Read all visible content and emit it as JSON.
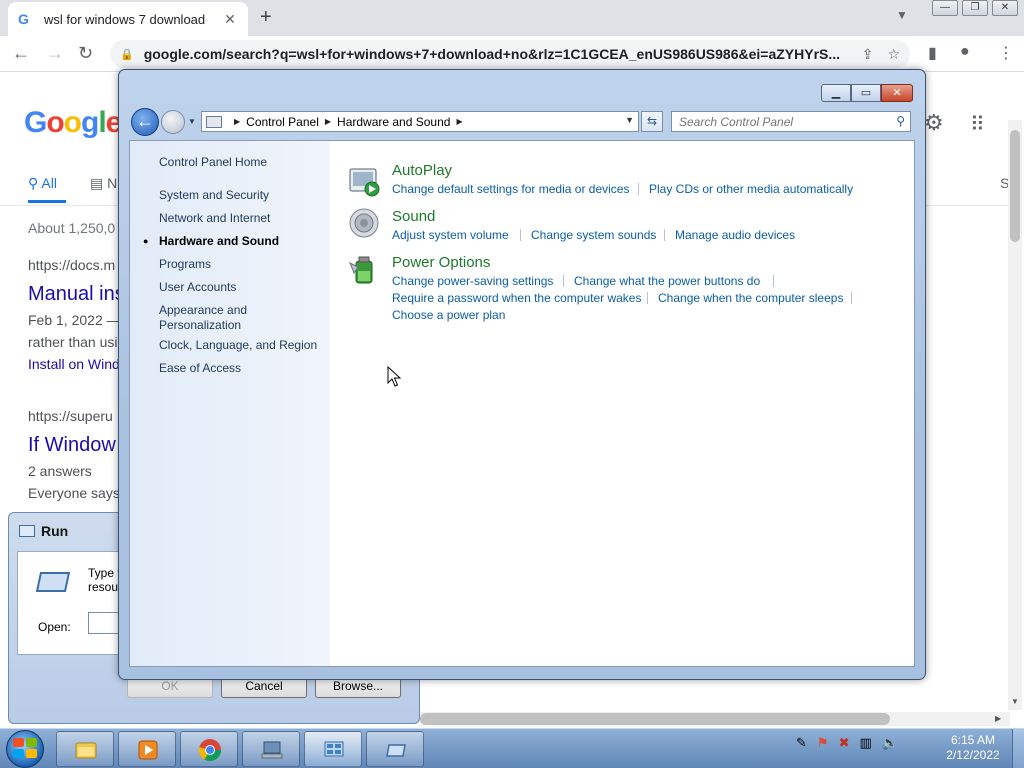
{
  "browser": {
    "tab_title": "wsl for windows 7 download",
    "tab_favicon": "G",
    "url": "google.com/search?q=wsl+for+windows+7+download+no&rlz=1C1GCEA_enUS986US986&ei=aZYHYrS..."
  },
  "google": {
    "logo": "Google",
    "tab_all": "All",
    "tab_n": "N",
    "tab_s": "S",
    "result_stats": "About 1,250,0",
    "result1_url": "https://docs.m",
    "result1_title": "Manual ins",
    "result1_snippet1": "Feb 1, 2022 —",
    "result1_snippet2": "rather than usi",
    "result1_link": "Install on Wind",
    "result2_url": "https://superu",
    "result2_title": "If Window",
    "result2_answers": "2 answers",
    "result2_snippet": "Everyone says,"
  },
  "run_dialog": {
    "title": "Run",
    "description": "Type th\nresourc",
    "open_label": "Open:",
    "ok_label": "OK",
    "cancel_label": "Cancel",
    "browse_label": "Browse..."
  },
  "control_panel": {
    "breadcrumb": [
      "Control Panel",
      "Hardware and Sound"
    ],
    "search_placeholder": "Search Control Panel",
    "nav": {
      "home": "Control Panel Home",
      "items": [
        "System and Security",
        "Network and Internet",
        "Hardware and Sound",
        "Programs",
        "User Accounts",
        "Appearance and",
        "Personalization",
        "Clock, Language, and Region",
        "Ease of Access"
      ]
    },
    "sections": {
      "autoplay": {
        "title": "AutoPlay",
        "links": [
          "Change default settings for media or devices",
          "Play CDs or other media automatically"
        ]
      },
      "sound": {
        "title": "Sound",
        "links": [
          "Adjust system volume",
          "Change system sounds",
          "Manage audio devices"
        ]
      },
      "power": {
        "title": "Power Options",
        "links": [
          "Change power-saving settings",
          "Change what the power buttons do",
          "Require a password when the computer wakes",
          "Change when the computer sleeps",
          "Choose a power plan"
        ]
      }
    }
  },
  "taskbar": {
    "time": "6:15 AM",
    "date": "2/12/2022"
  }
}
